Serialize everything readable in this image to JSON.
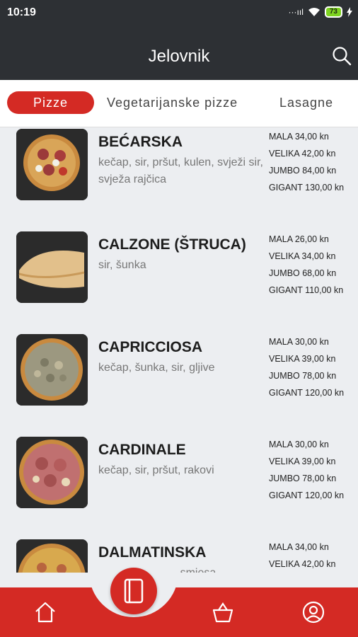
{
  "status": {
    "time": "10:19",
    "signal": "···ııl",
    "battery": "73"
  },
  "header": {
    "title": "Jelovnik"
  },
  "tabs": [
    {
      "label": "Pizze",
      "active": true
    },
    {
      "label": "Vegetarijanske pizze"
    },
    {
      "label": "Lasagne"
    }
  ],
  "items": [
    {
      "name": "BEĆARSKA",
      "desc": "kečap, sir, pršut, kulen, svježi sir, svježa rajčica",
      "prices": [
        "MALA 34,00 kn",
        "VELIKA 42,00 kn",
        "JUMBO 84,00 kn",
        "GIGANT 130,00 kn"
      ]
    },
    {
      "name": "CALZONE (ŠTRUCA)",
      "desc": "sir, šunka",
      "prices": [
        "MALA 26,00 kn",
        "VELIKA 34,00 kn",
        "JUMBO 68,00 kn",
        "GIGANT 110,00 kn"
      ]
    },
    {
      "name": "CAPRICCIOSA",
      "desc": "kečap, šunka, sir, gljive",
      "prices": [
        "MALA 30,00 kn",
        "VELIKA 39,00 kn",
        "JUMBO 78,00 kn",
        "GIGANT 120,00 kn"
      ]
    },
    {
      "name": "CARDINALE",
      "desc": "kečap, sir, pršut, rakovi",
      "prices": [
        "MALA 30,00 kn",
        "VELIKA 39,00 kn",
        "JUMBO 78,00 kn",
        "GIGANT 120,00 kn"
      ]
    },
    {
      "name": "DALMATINSKA",
      "desc": "kečap, sir, royal smjesa",
      "prices": [
        "MALA 34,00 kn",
        "VELIKA 42,00 kn"
      ]
    }
  ],
  "colors": {
    "accent": "#d42a24",
    "header": "#2d3034",
    "background": "#eceef1"
  },
  "nav": [
    "home-icon",
    "menu-book-icon",
    "basket-icon",
    "profile-icon"
  ]
}
